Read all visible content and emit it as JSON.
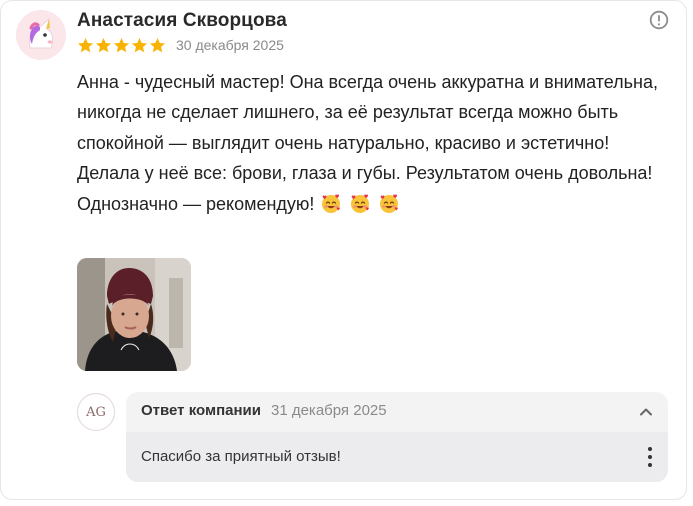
{
  "review": {
    "author": "Анастасия Скворцова",
    "rating": 5,
    "rating_max": 5,
    "date": "30 декабря 2025",
    "text": "Анна - чудесный мастер! Она всегда очень аккуратна и внимательна, никогда не сделает лишнего, за её результат всегда можно быть спокойной — выглядит очень натурально, красиво и эстетично! Делала у неё все: брови, глаза и губы. Результатом очень довольна! Однозначно — рекомендую!",
    "emoji_count": 3,
    "star_color": "#f8b300"
  },
  "reply": {
    "avatar_text": "AG",
    "title": "Ответ компании",
    "date": "31 декабря 2025",
    "text": "Спасибо за приятный отзыв!"
  },
  "icons": {
    "info": "info-icon",
    "chevron": "chevron-up-icon",
    "more": "more-vertical-icon"
  }
}
